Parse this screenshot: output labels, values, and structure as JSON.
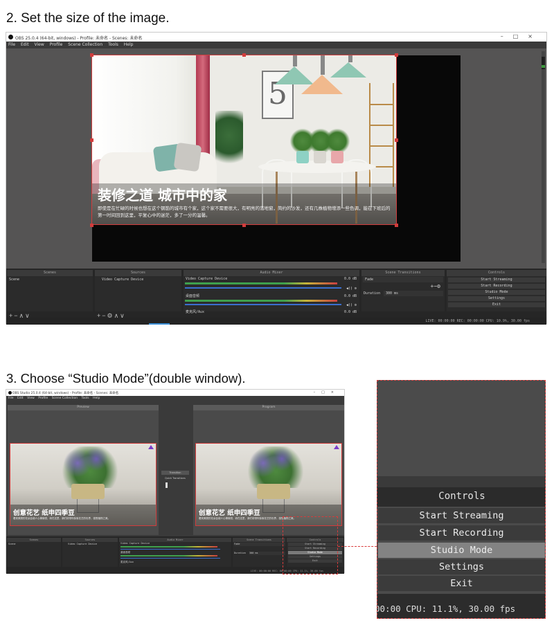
{
  "step2": {
    "title": "2. Set the size of the image."
  },
  "step3": {
    "title": "3. Choose “Studio Mode”(double window)."
  },
  "obs_window1": {
    "title": "OBS 25.0.4 (64-bit, windows) - Profile: 未命名 - Scenes: 未命名",
    "menu": [
      "File",
      "Edit",
      "View",
      "Profile",
      "Scene Collection",
      "Tools",
      "Help"
    ],
    "scene_heading": "装修之道 城市中的家",
    "scene_text": "即使是在忙碌的时候也想在这个钢筋的城市有个家，这个家不需要很大，有明亮的落地窗，简约的沙发，还有几株植物增添一些色调，能在下班后的第一时间回到这里，平复心中的迷茫，多了一分的温馨。",
    "docks": {
      "scenes_header": "Scenes",
      "scene_item": "Scene",
      "sources_header": "Sources",
      "source_item": "Video Capture Device",
      "mixer_header": "Audio Mixer",
      "mixer_ch1": "Video Capture Device",
      "mixer_ch1_db": "0.0 dB",
      "mixer_ch2": "桌面音频",
      "mixer_ch2_db": "0.0 dB",
      "mixer_ch3": "麦克风/Aux",
      "mixer_ch3_db": "0.0 dB",
      "transitions_header": "Scene Transitions",
      "transition_value": "Fade",
      "duration_label": "Duration",
      "duration_value": "300 ms",
      "controls_header": "Controls",
      "controls": [
        "Start Streaming",
        "Start Recording",
        "Studio Mode",
        "Settings",
        "Exit"
      ]
    },
    "status": "LIVE: 00:00:00   REC: 00:00:00   CPU: 10.9%, 30.00 fps"
  },
  "obs_window2": {
    "title": "OBS Studio 25.0.4 (64-bit, windows) - Profile: 未命名 - Scenes: 未命名",
    "menu": [
      "File",
      "Edit",
      "View",
      "Profile",
      "Scene Collection",
      "Tools",
      "Help"
    ],
    "preview_label": "Preview",
    "program_label": "Program",
    "transition_button": "Transition",
    "quick_transitions": "Quick Transitions",
    "flower_heading": "创意花艺 纸申四季豆",
    "flower_text": "看到美丽的花朵会使人心情愉悦，而在这里，我们将带你探索花艺的世界，感受植物之美。",
    "docks": {
      "scenes_header": "Scenes",
      "scene_item": "Scene",
      "sources_header": "Sources",
      "source_item": "Video Capture Device",
      "mixer_header": "Audio Mixer",
      "mixer_ch1": "Video Capture Device",
      "mixer_ch2": "桌面音频",
      "mixer_ch3": "麦克风/Aux",
      "transitions_header": "Scene Transitions",
      "transition_value": "Fade",
      "duration_label": "Duration",
      "duration_value": "300 ms",
      "controls_header": "Controls",
      "controls": [
        "Start Streaming",
        "Start Recording",
        "Studio Mode",
        "Settings",
        "Exit"
      ]
    },
    "status": "LIVE: 00:00:00   REC: 00:00:00   CPU: 11.1%, 30.00 fps"
  },
  "zoom_panel": {
    "header": "Controls",
    "buttons": [
      "Start Streaming",
      "Start Recording",
      "Studio Mode",
      "Settings",
      "Exit"
    ],
    "selected": "Studio Mode",
    "status": "00:00    CPU: 11.1%, 30.00 fps"
  },
  "colors": {
    "highlight": "#d93b3b",
    "selected_button": "#838383",
    "obs_bg": "#2e2e2e"
  }
}
